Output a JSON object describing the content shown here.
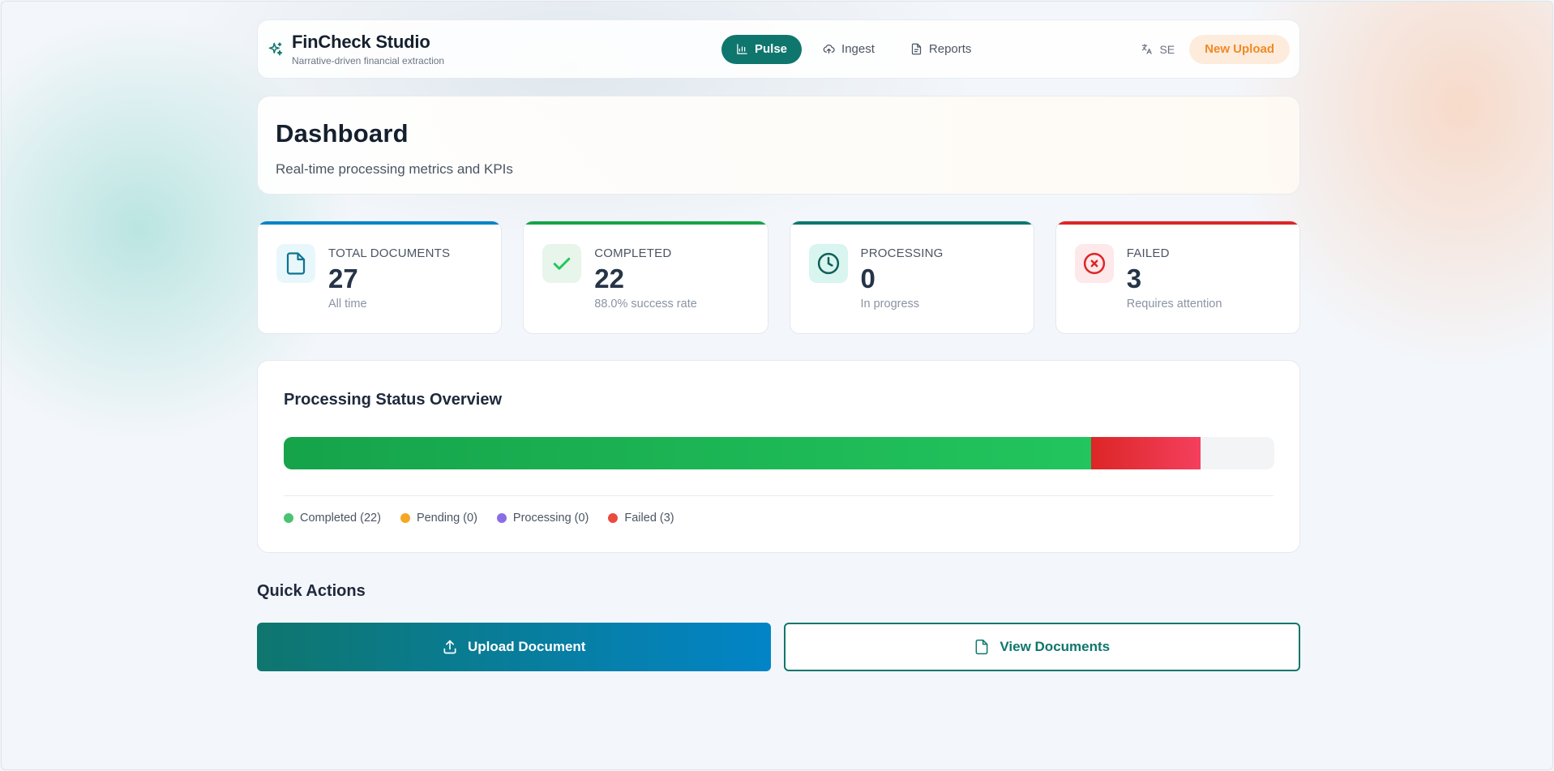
{
  "header": {
    "brand_title": "FinCheck Studio",
    "brand_subtitle": "Narrative-driven financial extraction",
    "nav": [
      {
        "label": "Pulse",
        "icon": "chart-icon",
        "active": true
      },
      {
        "label": "Ingest",
        "icon": "cloud-upload-icon",
        "active": false
      },
      {
        "label": "Reports",
        "icon": "document-icon",
        "active": false
      }
    ],
    "language": "SE",
    "new_upload_label": "New Upload"
  },
  "page": {
    "title": "Dashboard",
    "subtitle": "Real-time processing metrics and KPIs"
  },
  "stats": [
    {
      "label": "TOTAL DOCUMENTS",
      "value": "27",
      "sub": "All time",
      "icon": "file-icon",
      "accent": "#0284c7",
      "icon_bg": "#e8f7fb",
      "icon_color": "#0e7490"
    },
    {
      "label": "COMPLETED",
      "value": "22",
      "sub": "88.0% success rate",
      "icon": "check-icon",
      "accent": "#16a34a",
      "icon_bg": "#e7f5ea",
      "icon_color": "#22c55e"
    },
    {
      "label": "PROCESSING",
      "value": "0",
      "sub": "In progress",
      "icon": "clock-icon",
      "accent": "#0f766e",
      "icon_bg": "#d8f5ef",
      "icon_color": "#115e59"
    },
    {
      "label": "FAILED",
      "value": "3",
      "sub": "Requires attention",
      "icon": "x-circle-icon",
      "accent": "#dc2626",
      "icon_bg": "#fde8ea",
      "icon_color": "#dc2626"
    }
  ],
  "overview": {
    "title": "Processing Status Overview",
    "total": 27,
    "segments": [
      {
        "name": "Completed",
        "count": 22,
        "color_from": "#16a34a",
        "color_to": "#22c55e"
      },
      {
        "name": "Pending",
        "count": 0,
        "color_from": "#f59e0b",
        "color_to": "#f59e0b"
      },
      {
        "name": "Processing",
        "count": 0,
        "color_from": "#7c6ae8",
        "color_to": "#7c6ae8"
      },
      {
        "name": "Failed",
        "count": 3,
        "color_from": "#dc2626",
        "color_to": "#f43f5e"
      }
    ],
    "legend": [
      {
        "label": "Completed (22)",
        "color": "#4ac372"
      },
      {
        "label": "Pending (0)",
        "color": "#f5a623"
      },
      {
        "label": "Processing (0)",
        "color": "#8b6ce8"
      },
      {
        "label": "Failed (3)",
        "color": "#ea4a3f"
      }
    ]
  },
  "quick_actions": {
    "title": "Quick Actions",
    "upload_label": "Upload Document",
    "view_label": "View Documents"
  }
}
